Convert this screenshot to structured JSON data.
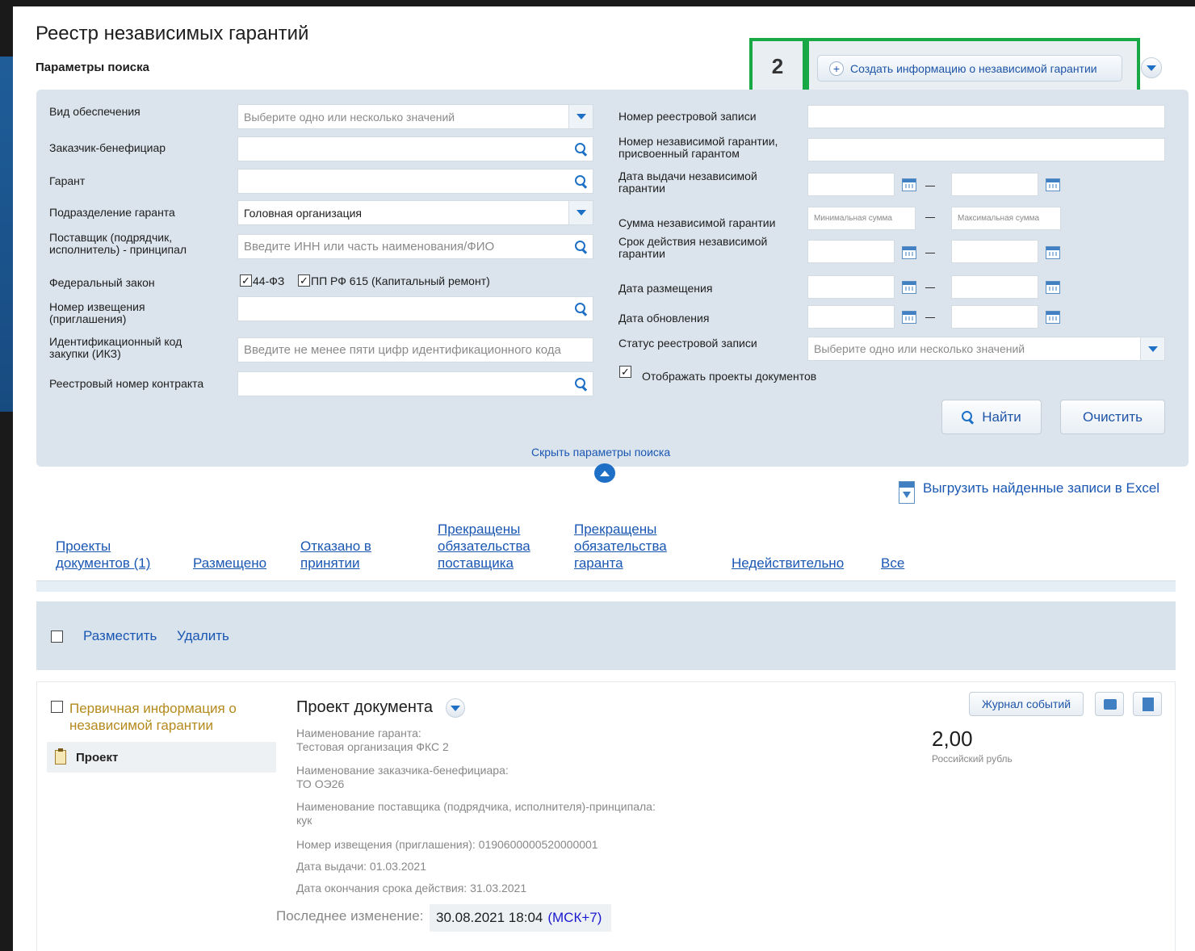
{
  "colors": {
    "accent": "#1e55a8",
    "highlight": "#18a846",
    "panel_bg": "#dbe4ec"
  },
  "page": {
    "title": "Реестр независимых гарантий",
    "params_title": "Параметры поиска"
  },
  "highlight": {
    "step_number": "2"
  },
  "header": {
    "create_button": "Создать информацию о независимой гарантии",
    "create_button_icon": "plus-circle-icon",
    "more_icon": "chevron-down-icon"
  },
  "search": {
    "left": {
      "provision_type": {
        "label": "Вид обеспечения",
        "placeholder": "Выберите одно или несколько значений"
      },
      "customer": {
        "label": "Заказчик-бенефициар",
        "value": ""
      },
      "guarantor": {
        "label": "Гарант",
        "value": ""
      },
      "guarantor_division": {
        "label": "Подразделение гаранта",
        "value": "Головная организация"
      },
      "supplier": {
        "label_1": "Поставщик (подрядчик,",
        "label_2": "исполнитель) - принципал",
        "placeholder": "Введите ИНН или часть наименования/ФИО"
      },
      "federal_law": {
        "label": "Федеральный закон",
        "option_1": "44-ФЗ",
        "option_2": "ПП РФ 615 (Капитальный ремонт)"
      },
      "notice_number": {
        "label_1": "Номер извещения",
        "label_2": "(приглашения)",
        "value": ""
      },
      "ikz": {
        "label_1": "Идентификационный код",
        "label_2": "закупки (ИКЗ)",
        "placeholder": "Введите не менее пяти цифр идентификационного кода"
      },
      "contract_number": {
        "label": "Реестровый номер контракта",
        "value": ""
      }
    },
    "right": {
      "registry_number": {
        "label": "Номер реестровой записи",
        "value": ""
      },
      "guarantee_number": {
        "label_1": "Номер независимой гарантии,",
        "label_2": "присвоенный гарантом",
        "value": ""
      },
      "issue_date": {
        "label_1": "Дата выдачи независимой",
        "label_2": "гарантии"
      },
      "amount": {
        "label": "Сумма независимой гарантии",
        "min_placeholder": "Минимальная сумма",
        "max_placeholder": "Максимальная сумма"
      },
      "validity": {
        "label_1": "Срок действия независимой",
        "label_2": "гарантии"
      },
      "placement_date": {
        "label": "Дата размещения"
      },
      "update_date": {
        "label": "Дата обновления"
      },
      "status": {
        "label": "Статус реестровой записи",
        "placeholder": "Выберите одно или несколько значений"
      },
      "show_drafts": {
        "label": "Отображать проекты документов",
        "checked": true
      }
    },
    "find_button": "Найти",
    "clear_button": "Очистить",
    "hide_link": "Скрыть параметры поиска"
  },
  "export_link": "Выгрузить найденные записи в Excel",
  "tabs": [
    {
      "line1": "Проекты",
      "line2": "документов (1)"
    },
    {
      "line1": "",
      "line2": "Размещено"
    },
    {
      "line1": "Отказано в",
      "line2": "принятии"
    },
    {
      "line0": "Прекращены",
      "line1": "обязательства",
      "line2": "поставщика"
    },
    {
      "line0": "Прекращены",
      "line1": "обязательства",
      "line2": "гаранта"
    },
    {
      "line1": "",
      "line2": "Недействительно"
    },
    {
      "line1": "",
      "line2": "Все"
    }
  ],
  "actions": {
    "place": "Разместить",
    "delete": "Удалить"
  },
  "record": {
    "title_line1": "Первичная информация о",
    "title_line2": "независимой гарантии",
    "status": "Проект",
    "doc_title": "Проект документа",
    "event_log_button": "Журнал событий",
    "guarantor_label": "Наименование гаранта:",
    "guarantor_value": "Тестовая организация ФКС 2",
    "customer_label": "Наименование заказчика-бенефициара:",
    "customer_value": "ТО ОЭ26",
    "supplier_label": "Наименование поставщика (подрядчика, исполнителя)-принципала:",
    "supplier_value": "кук",
    "notice": "Номер извещения (приглашения): 0190600000520000001",
    "issue_date": "Дата выдачи: 01.03.2021",
    "end_date": "Дата окончания срока действия: 31.03.2021",
    "amount": "2,00",
    "currency": "Российский рубль",
    "last_change_label": "Последнее изменение:",
    "last_change_value": "30.08.2021 18:04",
    "timezone": "(МСК+7)"
  }
}
